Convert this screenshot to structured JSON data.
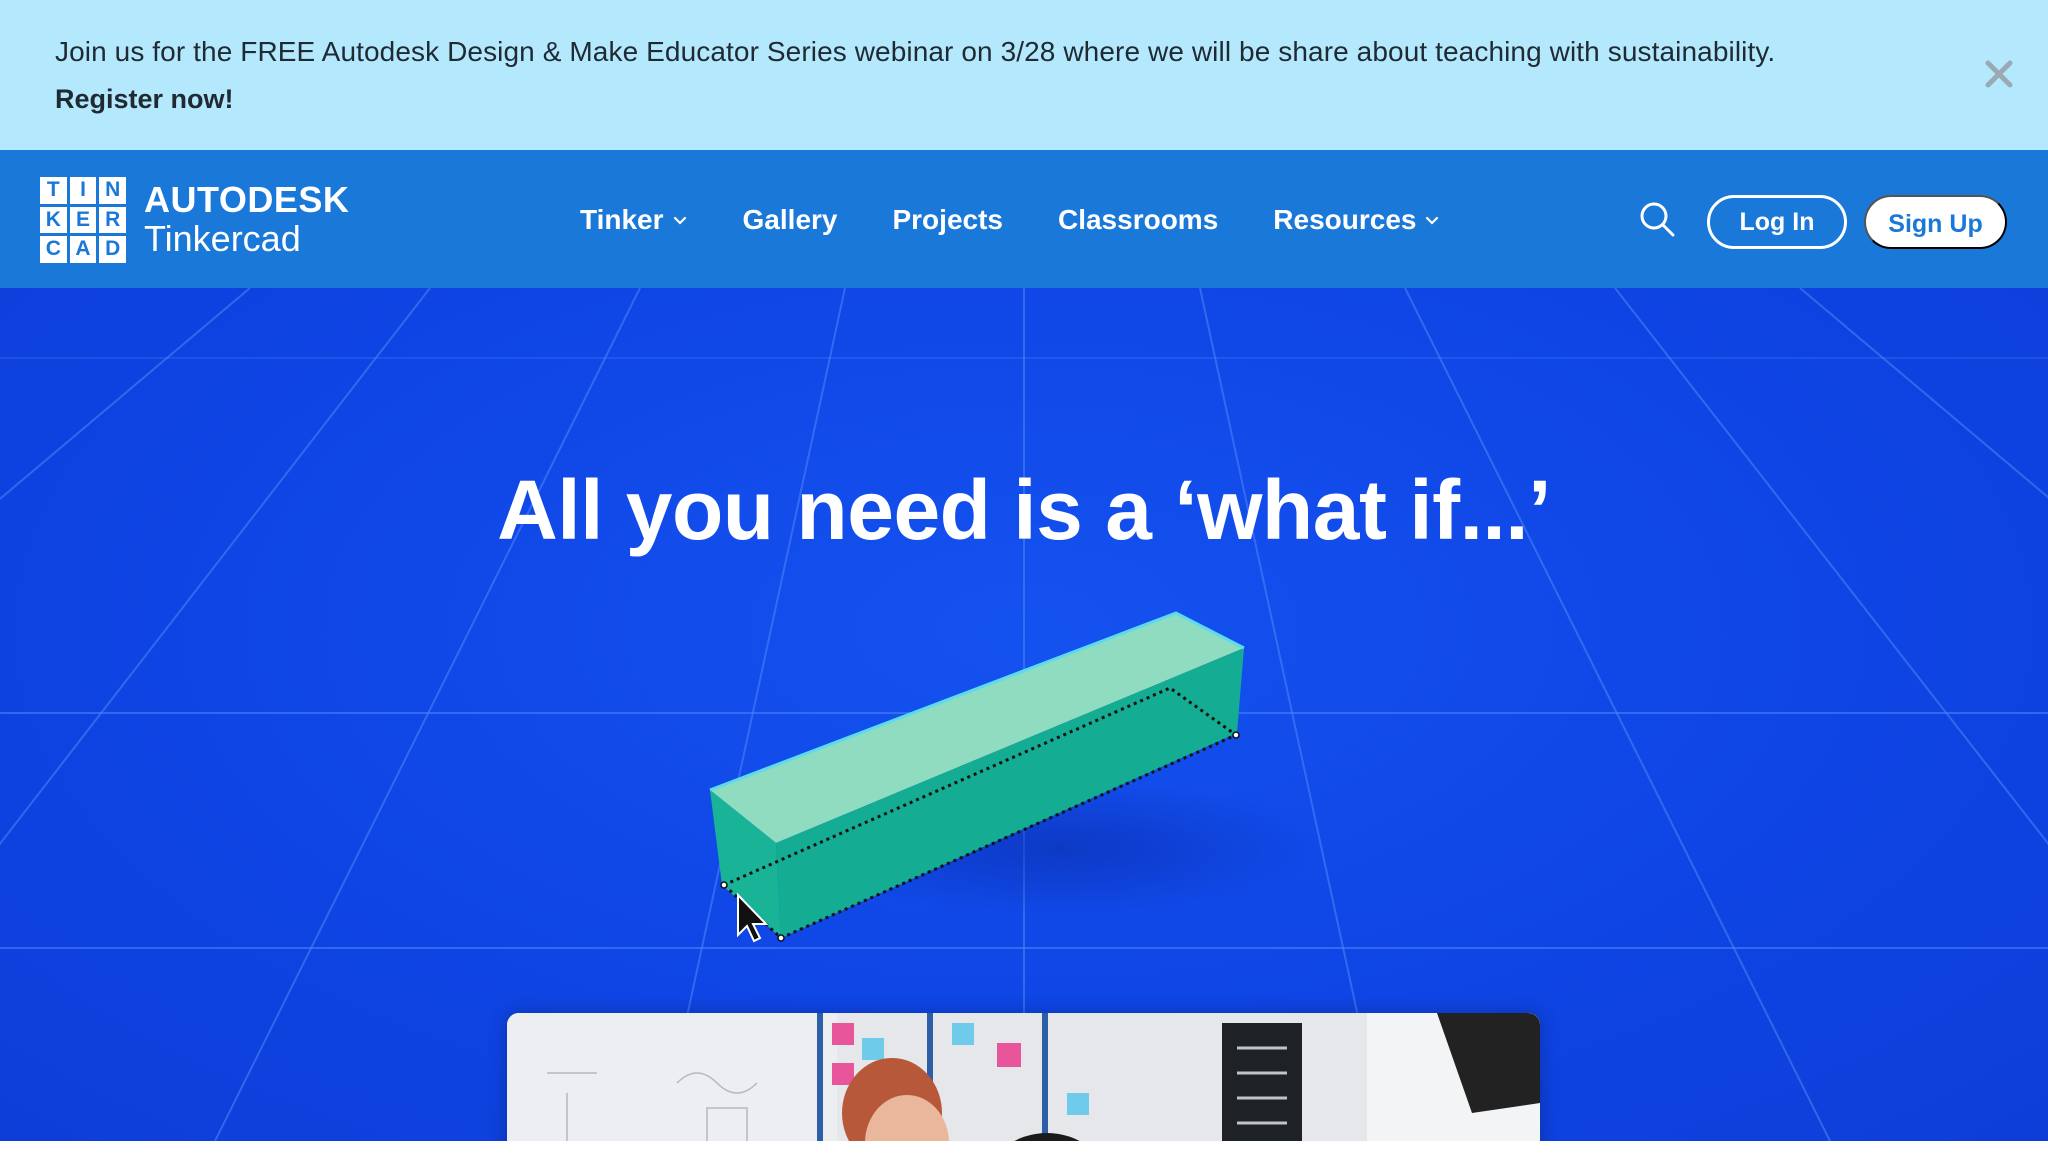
{
  "banner": {
    "message": "Join us for the FREE Autodesk Design & Make Educator Series webinar on 3/28 where we will be share about teaching with sustainability.",
    "link_label": "Register now!",
    "close_icon": "close-icon"
  },
  "header": {
    "logo_letters": [
      "T",
      "I",
      "N",
      "K",
      "E",
      "R",
      "C",
      "A",
      "D"
    ],
    "brand": "AUTODESK",
    "product": "Tinkercad",
    "nav": [
      {
        "label": "Tinker",
        "has_dropdown": true
      },
      {
        "label": "Gallery",
        "has_dropdown": false
      },
      {
        "label": "Projects",
        "has_dropdown": false
      },
      {
        "label": "Classrooms",
        "has_dropdown": false
      },
      {
        "label": "Resources",
        "has_dropdown": true
      }
    ],
    "search_icon": "search-icon",
    "login_label": "Log In",
    "signup_label": "Sign Up"
  },
  "hero": {
    "title": "All you need is a ‘what if...’"
  },
  "colors": {
    "banner_bg": "#b4e8fd",
    "header_bg": "#1a78d8",
    "hero_bg": "#0f45e5",
    "shape": "#1fb79a"
  }
}
